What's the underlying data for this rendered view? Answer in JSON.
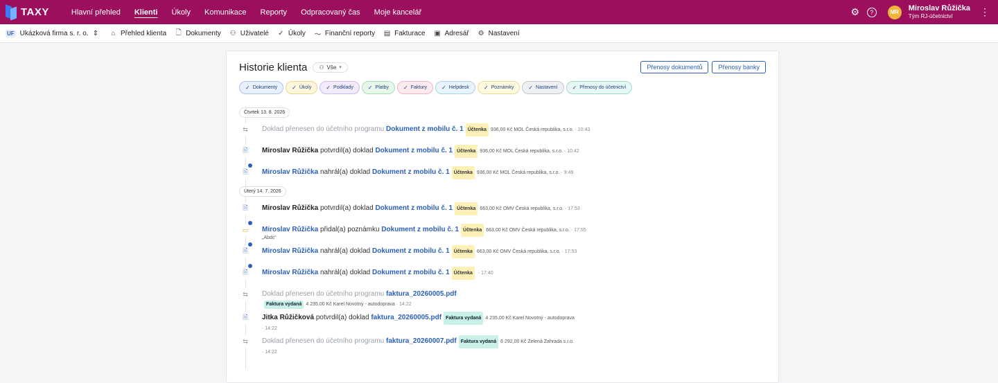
{
  "brand": {
    "name": "TAXY"
  },
  "topnav": [
    {
      "label": "Hlavní přehled",
      "active": false
    },
    {
      "label": "Klienti",
      "active": true
    },
    {
      "label": "Úkoly",
      "active": false
    },
    {
      "label": "Komunikace",
      "active": false
    },
    {
      "label": "Reporty",
      "active": false
    },
    {
      "label": "Odpracovaný čas",
      "active": false
    },
    {
      "label": "Moje kancelář",
      "active": false
    }
  ],
  "user": {
    "initials": "MR",
    "name": "Miroslav Růžička",
    "team": "Tým RJ-účetnictví"
  },
  "company": {
    "badge": "UF",
    "name": "Ukázková firma s. r. o."
  },
  "subnav": [
    {
      "label": "Přehled klienta",
      "icon": "home-icon",
      "glyph": "⌂"
    },
    {
      "label": "Dokumenty",
      "icon": "document-icon",
      "glyph": "🗋"
    },
    {
      "label": "Uživatelé",
      "icon": "users-icon",
      "glyph": "⚇"
    },
    {
      "label": "Úkoly",
      "icon": "check-circle-icon",
      "glyph": "✓"
    },
    {
      "label": "Finanční reporty",
      "icon": "chart-line-icon",
      "glyph": "〜"
    },
    {
      "label": "Fakturace",
      "icon": "invoice-icon",
      "glyph": "▤"
    },
    {
      "label": "Adresář",
      "icon": "address-book-icon",
      "glyph": "▣"
    },
    {
      "label": "Nastavení",
      "icon": "gear-icon",
      "glyph": "⚙"
    }
  ],
  "history": {
    "title": "Historie klienta",
    "filter": "Vše",
    "buttons": {
      "doc_transfers": "Přenosy dokumentů",
      "bank_transfers": "Přenosy banky"
    },
    "chips": [
      {
        "label": "Dokumenty",
        "bg": "#e8f0fc",
        "border": "#a9c2ec"
      },
      {
        "label": "Úkoly",
        "bg": "#fdf6dc",
        "border": "#ecd58a"
      },
      {
        "label": "Podklady",
        "bg": "#f1ebfb",
        "border": "#cdb8ef"
      },
      {
        "label": "Platby",
        "bg": "#e7f7ec",
        "border": "#a8dcb8"
      },
      {
        "label": "Faktury",
        "bg": "#fcebee",
        "border": "#f0b3bf"
      },
      {
        "label": "Helpdesk",
        "bg": "#e8f4fa",
        "border": "#a8d4ea"
      },
      {
        "label": "Poznámky",
        "bg": "#fdf8e0",
        "border": "#eadb94"
      },
      {
        "label": "Nastavení",
        "bg": "#eef0f3",
        "border": "#bfc5cf"
      },
      {
        "label": "Přenosy do účetnictví",
        "bg": "#e6f7f4",
        "border": "#9fdacf"
      }
    ],
    "groups": [
      {
        "date": "Čtvrtek 13. 8. 2026",
        "items": [
          {
            "kind": "transfer",
            "actor": "",
            "verb": "Doklad přenesen do účetního programu",
            "doc": "Dokument z mobilu č. 1",
            "tag": "Účtenka",
            "amount": "936,00 Kč",
            "party": "MOL Česká republika, s.r.o.",
            "time": "10:43",
            "note": "",
            "dot": false,
            "wrap": false
          },
          {
            "kind": "doc",
            "actor": "Miroslav Růžička",
            "verb": "potvrdil(a) doklad",
            "doc": "Dokument z mobilu č. 1",
            "tag": "Účtenka",
            "amount": "936,00 Kč",
            "party": "MOL Česká republika, s.r.o.",
            "time": "10:42",
            "note": "",
            "dot": false,
            "wrap": false
          },
          {
            "kind": "doc",
            "actor": "Miroslav Růžička",
            "verb": "nahrál(a) doklad",
            "doc": "Dokument z mobilu č. 1",
            "tag": "Účtenka",
            "amount": "936,00 Kč",
            "party": "MOL Česká republika, s.r.o.",
            "time": "9:49",
            "note": "",
            "dot": true,
            "wrap": false
          }
        ]
      },
      {
        "date": "Úterý 14. 7. 2026",
        "items": [
          {
            "kind": "doc",
            "actor": "Miroslav Růžička",
            "verb": "potvrdil(a) doklad",
            "doc": "Dokument z mobilu č. 1",
            "tag": "Účtenka",
            "amount": "663,00 Kč",
            "party": "OMV Česká republika, s.r.o.",
            "time": "17:53",
            "note": "",
            "dot": false,
            "wrap": false
          },
          {
            "kind": "note",
            "actor": "Miroslav Růžička",
            "verb": "přidal(a) poznámku",
            "doc": "Dokument z mobilu č. 1",
            "tag": "Účtenka",
            "amount": "663,00 Kč",
            "party": "OMV Česká republika, s.r.o.",
            "time": "17:55",
            "note": "„Abdc“",
            "dot": true,
            "wrap": false
          },
          {
            "kind": "doc",
            "actor": "Miroslav Růžička",
            "verb": "nahrál(a) doklad",
            "doc": "Dokument z mobilu č. 1",
            "tag": "Účtenka",
            "amount": "663,00 Kč",
            "party": "OMV Česká republika, s.r.o.",
            "time": "17:53",
            "note": "",
            "dot": true,
            "wrap": false
          },
          {
            "kind": "doc",
            "actor": "Miroslav Růžička",
            "verb": "nahrál(a) doklad",
            "doc": "Dokument z mobilu č. 1",
            "tag": "Účtenka",
            "amount": "",
            "party": "",
            "time": "17:40",
            "note": "",
            "dot": true,
            "wrap": false
          },
          {
            "kind": "transfer",
            "actor": "",
            "verb": "Doklad přenesen do účetního programu",
            "doc": "faktura_20260005.pdf",
            "tag": "Faktura vydaná",
            "amount": "4 235,00 Kč",
            "party": "Karel Novotný - autodoprava",
            "time": "14:22",
            "note": "",
            "dot": false,
            "wrap": true
          },
          {
            "kind": "doc",
            "actor": "Jitka Růžičková",
            "verb": "potvrdil(a) doklad",
            "doc": "faktura_20260005.pdf",
            "tag": "Faktura vydaná",
            "amount": "4 235,00 Kč",
            "party": "Karel Novotný - autodoprava",
            "time": "14:22",
            "note": "",
            "dot": false,
            "wrap": "time"
          },
          {
            "kind": "transfer",
            "actor": "",
            "verb": "Doklad přenesen do účetního programu",
            "doc": "faktura_20260007.pdf",
            "tag": "Faktura vydaná",
            "amount": "6 292,00 Kč",
            "party": "Zelená Zahrada s.r.o.",
            "time": "14:22",
            "note": "",
            "dot": false,
            "wrap": "time"
          }
        ]
      }
    ]
  }
}
